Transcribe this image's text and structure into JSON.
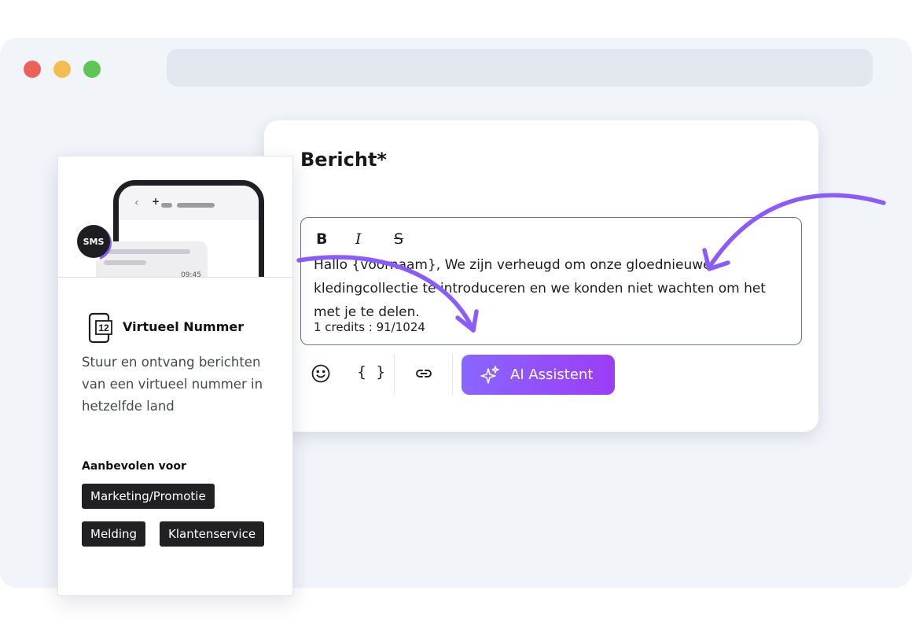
{
  "message": {
    "title": "Bericht*",
    "format_bold": "B",
    "format_italic": "I",
    "format_strike": "S",
    "body": "Hallo {voornaam}, We zijn verheugd om onze gloednieuwe kledingcollectie te introduceren en we konden niet wachten om het met je te delen.",
    "credits": "1 credits : 91/1024",
    "braces_label": "{ }",
    "ai_button_label": "AI Assistent"
  },
  "number_card": {
    "sms_badge": "SMS",
    "bubble_time": "09:45",
    "icon_number": "12",
    "title": "Virtueel Nummer",
    "description": "Stuur en ontvang berichten van een virtueel nummer in hetzelfde land",
    "recommended_label": "Aanbevolen voor",
    "tags": [
      "Marketing/Promotie",
      "Melding",
      "Klantenservice"
    ]
  },
  "colors": {
    "accent": "#8a5cff",
    "ai_gradient_start": "#8a66ff",
    "ai_gradient_end": "#9b3df5",
    "tag_bg": "#212124",
    "window_bg": "#f1f4f9"
  },
  "icons": [
    "bold-icon",
    "italic-icon",
    "strikethrough-icon",
    "emoji-icon",
    "variable-braces-icon",
    "link-icon",
    "sparkle-icon",
    "phone-number-icon",
    "chevron-left-icon"
  ]
}
